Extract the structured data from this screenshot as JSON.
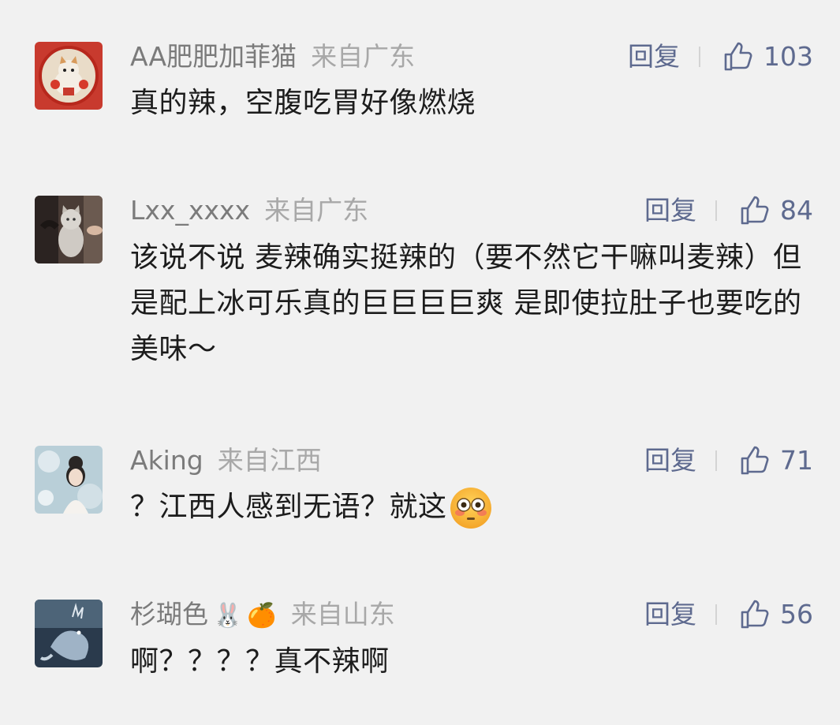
{
  "comments": [
    {
      "username": "AA肥肥加菲猫",
      "location": "来自广东",
      "reply_label": "回复",
      "likes": "103",
      "text": "真的辣，空腹吃胃好像燃烧",
      "avatar_icon": "cat-new-year-avatar-icon"
    },
    {
      "username": "Lxx_xxxx",
      "location": "来自广东",
      "reply_label": "回复",
      "likes": "84",
      "text": "该说不说 麦辣确实挺辣的（要不然它干嘛叫麦辣）但是配上冰可乐真的巨巨巨巨爽 是即使拉肚子也要吃的美味～",
      "avatar_icon": "kitten-photo-avatar-icon"
    },
    {
      "username": "Aking",
      "location": "来自江西",
      "reply_label": "回复",
      "likes": "71",
      "text": "？江西人感到无语？就这",
      "trailing_emoji": "flushed-face-emoji",
      "avatar_icon": "girl-portrait-avatar-icon"
    },
    {
      "username": "杉瑚色",
      "name_badges": [
        "🐰",
        "🍊"
      ],
      "location": "来自山东",
      "reply_label": "回复",
      "likes": "56",
      "text": "啊？？？？真不辣啊",
      "avatar_icon": "fantasy-creature-avatar-icon"
    }
  ],
  "colors": {
    "background": "#f1f1f1",
    "username": "#7b7b7b",
    "location": "#a8a8a8",
    "action": "#5e6a8f",
    "text": "#1c1c1c"
  }
}
